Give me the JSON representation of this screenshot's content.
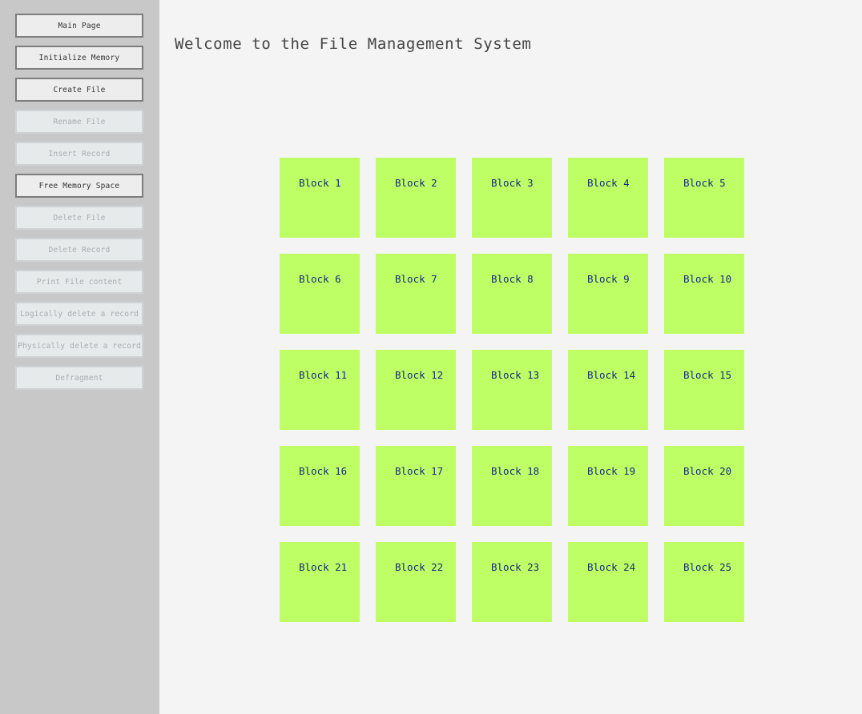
{
  "page": {
    "title": "Welcome to the File Management System"
  },
  "sidebar": {
    "buttons": [
      {
        "label": "Main Page",
        "enabled": true
      },
      {
        "label": "Initialize Memory",
        "enabled": true
      },
      {
        "label": "Create File",
        "enabled": true
      },
      {
        "label": "Rename File",
        "enabled": false
      },
      {
        "label": "Insert Record",
        "enabled": false
      },
      {
        "label": "Free Memory Space",
        "enabled": true
      },
      {
        "label": "Delete File",
        "enabled": false
      },
      {
        "label": "Delete Record",
        "enabled": false
      },
      {
        "label": "Print File content",
        "enabled": false
      },
      {
        "label": "Logically delete a record",
        "enabled": false
      },
      {
        "label": "Physically delete a record",
        "enabled": false
      },
      {
        "label": "Defragment",
        "enabled": false
      }
    ]
  },
  "blocks": [
    "Block 1",
    "Block 2",
    "Block 3",
    "Block 4",
    "Block 5",
    "Block 6",
    "Block 7",
    "Block 8",
    "Block 9",
    "Block 10",
    "Block 11",
    "Block 12",
    "Block 13",
    "Block 14",
    "Block 15",
    "Block 16",
    "Block 17",
    "Block 18",
    "Block 19",
    "Block 20",
    "Block 21",
    "Block 22",
    "Block 23",
    "Block 24",
    "Block 25"
  ],
  "colors": {
    "block_free": "#bdff64",
    "block_label": "#1a2a7a",
    "sidebar_bg": "#c8c8c8"
  }
}
